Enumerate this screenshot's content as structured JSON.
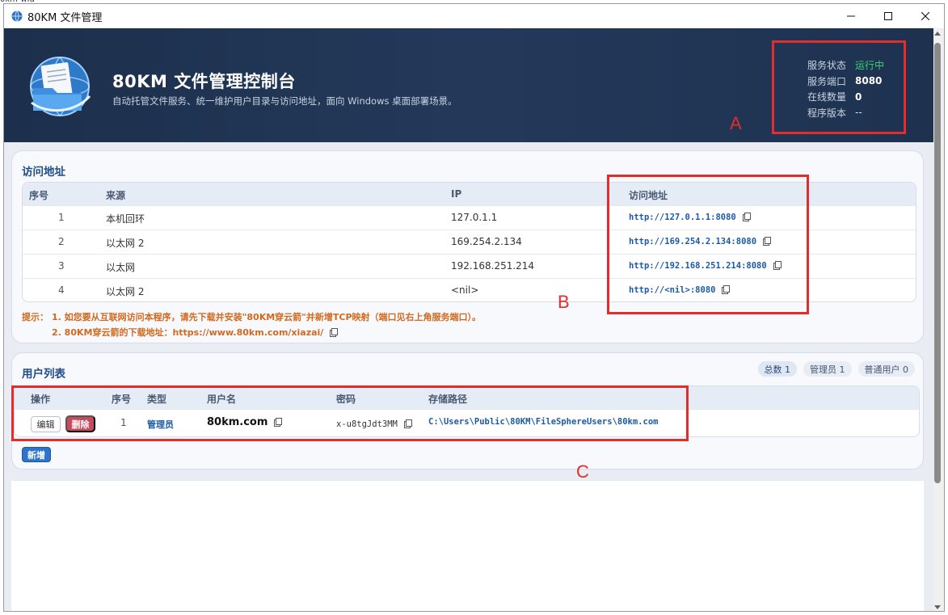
{
  "window": {
    "stray_label": "0km-wid",
    "title": "80KM 文件管理",
    "icon": "globe-app-icon",
    "controls": [
      "minimize-icon",
      "maximize-icon",
      "close-icon"
    ]
  },
  "header": {
    "title": "80KM 文件管理控制台",
    "subtitle": "自动托管文件服务、统一维护用户目录与访问地址，面向 Windows 桌面部署场景。",
    "logo": "folder-globe-logo",
    "status": {
      "service_state_label": "服务状态",
      "service_state_value": "运行中",
      "port_label": "服务端口",
      "port_value": "8080",
      "online_label": "在线数量",
      "online_value": "0",
      "version_label": "程序版本",
      "version_value": "--"
    }
  },
  "access": {
    "title": "访问地址",
    "columns": [
      "序号",
      "来源",
      "IP",
      "访问地址"
    ],
    "rows": [
      {
        "index": "1",
        "source": "本机回环",
        "ip": "127.0.1.1",
        "url": "http://127.0.1.1:8080"
      },
      {
        "index": "2",
        "source": "以太网 2",
        "ip": "169.254.2.134",
        "url": "http://169.254.2.134:8080"
      },
      {
        "index": "3",
        "source": "以太网",
        "ip": "192.168.251.214",
        "url": "http://192.168.251.214:8080"
      },
      {
        "index": "4",
        "source": "以太网 2",
        "ip": "<nil>",
        "url": "http://<nil>:8080"
      }
    ],
    "tip_label": "提示：",
    "tip_1": "1. 如您要从互联网访问本程序，请先下载并安装\"80KM穿云箭\"并新增TCP映射（端口见右上角服务端口）。",
    "tip_2": "2. 80KM穿云箭的下载地址：https://www.80km.com/xiazai/"
  },
  "users": {
    "title": "用户列表",
    "badges": {
      "total": "总数 1",
      "admins": "管理员 1",
      "normal": "普通用户 0"
    },
    "columns": [
      "操作",
      "序号",
      "类型",
      "用户名",
      "密码",
      "存储路径"
    ],
    "rows": [
      {
        "edit_label": "编辑",
        "delete_label": "删除",
        "index": "1",
        "type": "管理员",
        "username": "80km.com",
        "password": "x-u8tgJdt3MM",
        "path": "C:\\Users\\Public\\80KM\\FileSphereUsers\\80km.com"
      }
    ],
    "add_label": "新增"
  },
  "annotations": {
    "a": "A",
    "b": "B",
    "c": "C",
    "color": "#e52b2b"
  },
  "colors": {
    "header_bg": "#1c2f4c",
    "accent_blue": "#1d5aa6",
    "running_green": "#3bd07a",
    "tip_orange": "#d2691e",
    "delete_red": "#c74b5e"
  }
}
